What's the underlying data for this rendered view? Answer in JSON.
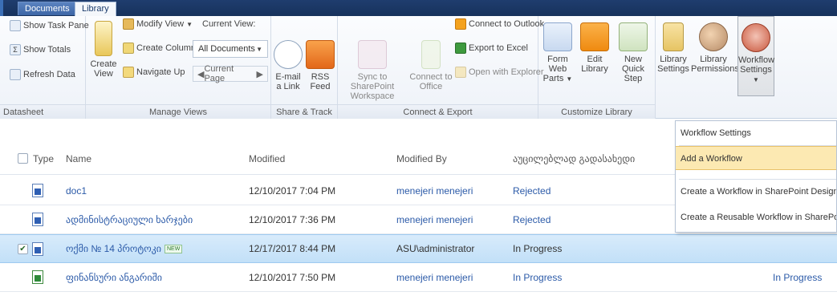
{
  "tabs": {
    "documents": "Documents",
    "library": "Library"
  },
  "ribbon": {
    "datasheet": {
      "show_task_pane": "Show Task Pane",
      "show_totals": "Show Totals",
      "refresh_data": "Refresh Data",
      "label": "Datasheet"
    },
    "manage_views": {
      "create_view": "Create View",
      "modify_view": "Modify View",
      "create_column": "Create Column",
      "navigate_up": "Navigate Up",
      "current_view_label": "Current View:",
      "current_view_value": "All Documents",
      "current_page": "Current Page",
      "label": "Manage Views"
    },
    "share_track": {
      "email_link": "E-mail a Link",
      "rss_feed": "RSS Feed",
      "label": "Share & Track"
    },
    "connect_export": {
      "sync_sharepoint": "Sync to SharePoint Workspace",
      "connect_office": "Connect to Office",
      "connect_outlook": "Connect to Outlook",
      "export_excel": "Export to Excel",
      "open_explorer": "Open with Explorer",
      "label": "Connect & Export"
    },
    "customize_library": {
      "form_web_parts": "Form Web Parts",
      "edit_library": "Edit Library",
      "new_quick_step": "New Quick Step",
      "label": "Customize Library"
    },
    "settings": {
      "library_settings": "Library Settings",
      "library_permissions": "Library Permissions",
      "workflow_settings": "Workflow Settings"
    }
  },
  "workflow_menu": {
    "items": [
      "Workflow Settings",
      "Add a Workflow",
      "Create a Workflow in SharePoint Designer",
      "Create a Reusable Workflow in SharePoint Desi"
    ]
  },
  "list": {
    "headers": {
      "type": "Type",
      "name": "Name",
      "modified": "Modified",
      "modified_by": "Modified By",
      "approval": "აუცილებლად გადასახედი"
    },
    "new_badge": "NEW",
    "rows": [
      {
        "name": "doc1",
        "modified": "12/10/2017 7:04 PM",
        "modified_by": "menejeri menejeri",
        "status": "Rejected",
        "extra": "",
        "icon": "word-doc-icon"
      },
      {
        "name": "ადმინისტრაციული ხარჯები",
        "modified": "12/10/2017 7:36 PM",
        "modified_by": "menejeri menejeri",
        "status": "Rejected",
        "extra": "",
        "icon": "word-doc-icon"
      },
      {
        "name": "ოქმი № 14 პროტოკი",
        "modified": "12/17/2017 8:44 PM",
        "modified_by": "ASU\\administrator",
        "status": "In Progress",
        "extra": "",
        "icon": "word-doc-icon"
      },
      {
        "name": "ფინანსური ანგარიში",
        "modified": "12/10/2017 7:50 PM",
        "modified_by": "menejeri menejeri",
        "status": "In Progress",
        "extra": "In Progress",
        "icon": "excel-doc-icon"
      }
    ]
  },
  "colors": {
    "topbar": "#1f3d6e",
    "link": "#2b5aa8",
    "selected_row": "#c2e0f8",
    "menu_highlight": "#fce9b2"
  }
}
